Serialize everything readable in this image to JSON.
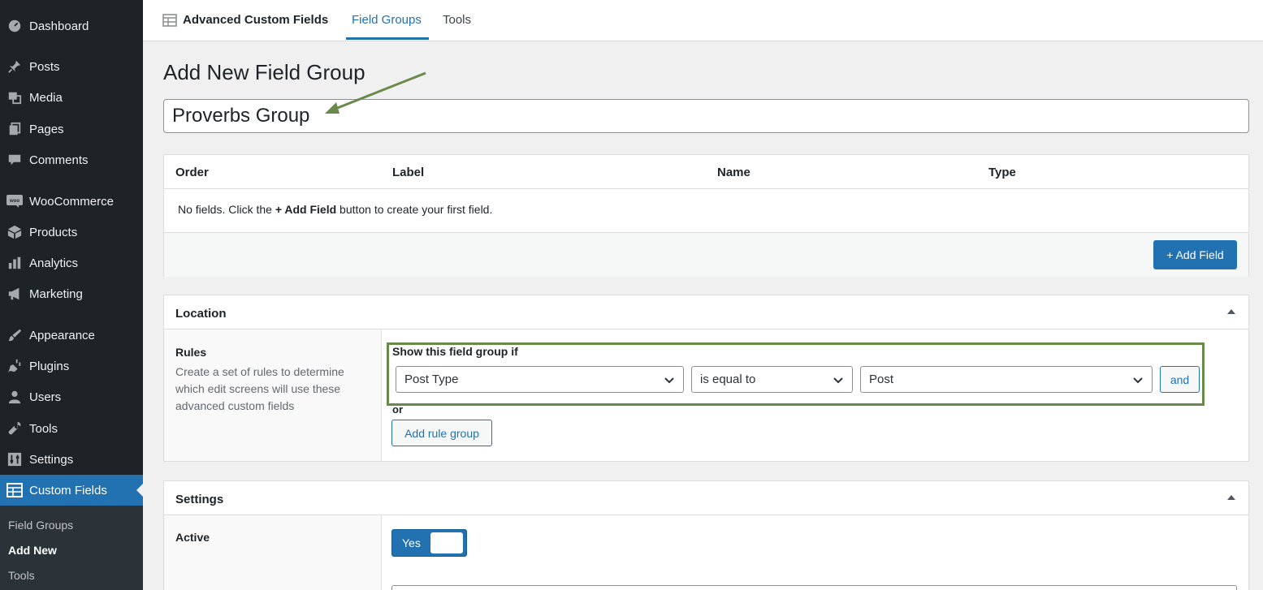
{
  "sidebar": {
    "items": [
      {
        "label": "Dashboard",
        "icon": "dashboard-icon"
      },
      {
        "label": "Posts",
        "icon": "pin-icon"
      },
      {
        "label": "Media",
        "icon": "media-icon"
      },
      {
        "label": "Pages",
        "icon": "pages-icon"
      },
      {
        "label": "Comments",
        "icon": "comments-icon"
      },
      {
        "label": "WooCommerce",
        "icon": "woocommerce-icon"
      },
      {
        "label": "Products",
        "icon": "archive-icon"
      },
      {
        "label": "Analytics",
        "icon": "bar-chart-icon"
      },
      {
        "label": "Marketing",
        "icon": "megaphone-icon"
      },
      {
        "label": "Appearance",
        "icon": "paintbrush-icon"
      },
      {
        "label": "Plugins",
        "icon": "plug-icon"
      },
      {
        "label": "Users",
        "icon": "user-icon"
      },
      {
        "label": "Tools",
        "icon": "wrench-icon"
      },
      {
        "label": "Settings",
        "icon": "settings-sliders-icon"
      },
      {
        "label": "Custom Fields",
        "icon": "table-icon"
      }
    ],
    "submenu": [
      "Field Groups",
      "Add New",
      "Tools"
    ]
  },
  "topbar": {
    "brand": "Advanced Custom Fields",
    "tabs": [
      "Field Groups",
      "Tools"
    ]
  },
  "page": {
    "title": "Add New Field Group",
    "group_title_value": "Proverbs Group"
  },
  "fields_table": {
    "columns": [
      "Order",
      "Label",
      "Name",
      "Type"
    ],
    "empty_prefix": "No fields. Click the ",
    "empty_bold": "+ Add Field",
    "empty_suffix": " button to create your first field.",
    "add_button": "+ Add Field"
  },
  "location": {
    "heading": "Location",
    "rules_label": "Rules",
    "rules_desc": "Create a set of rules to determine which edit screens will use these advanced custom fields",
    "show_if": "Show this field group if",
    "param": "Post Type",
    "operator": "is equal to",
    "value": "Post",
    "and_button": "and",
    "or_label": "or",
    "add_rule_group": "Add rule group"
  },
  "settings": {
    "heading": "Settings",
    "active_label": "Active",
    "active_toggle": "Yes"
  },
  "colors": {
    "accent": "#2271b1",
    "sidebar_bg": "#1d2327",
    "annotation": "#6a8a4b"
  }
}
